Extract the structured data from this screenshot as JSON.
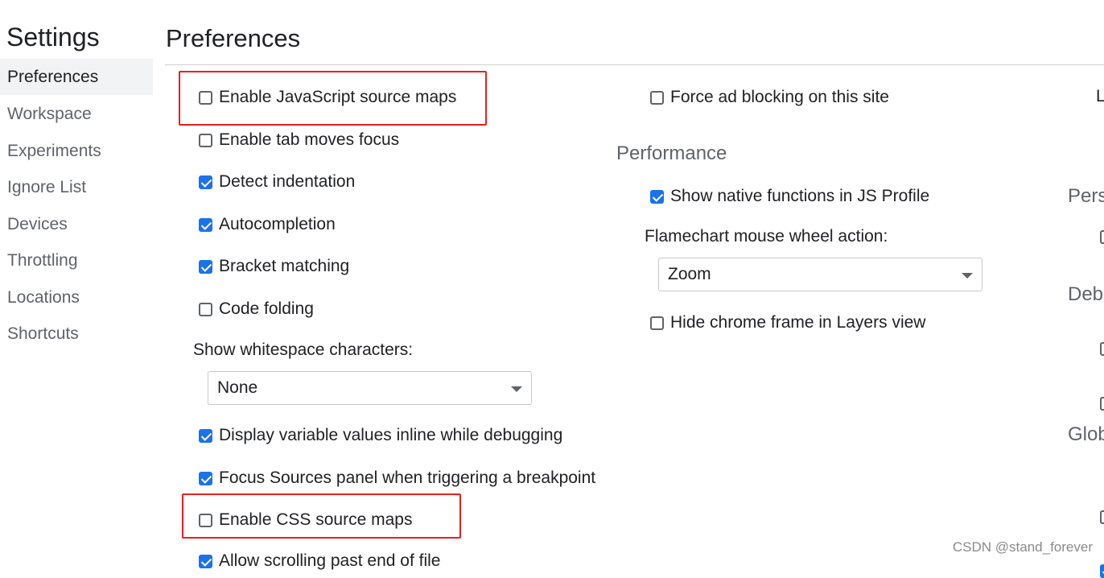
{
  "sidebar": {
    "title": "Settings",
    "items": [
      {
        "label": "Preferences",
        "selected": true
      },
      {
        "label": "Workspace"
      },
      {
        "label": "Experiments"
      },
      {
        "label": "Ignore List"
      },
      {
        "label": "Devices"
      },
      {
        "label": "Throttling"
      },
      {
        "label": "Locations"
      },
      {
        "label": "Shortcuts"
      }
    ]
  },
  "main": {
    "title": "Preferences",
    "left_column": {
      "js_source_maps": {
        "label": "Enable JavaScript source maps",
        "checked": false
      },
      "tab_moves_focus": {
        "label": "Enable tab moves focus",
        "checked": false
      },
      "detect_indentation": {
        "label": "Detect indentation",
        "checked": true
      },
      "autocompletion": {
        "label": "Autocompletion",
        "checked": true
      },
      "bracket_matching": {
        "label": "Bracket matching",
        "checked": true
      },
      "code_folding": {
        "label": "Code folding",
        "checked": false
      },
      "whitespace_label": "Show whitespace characters:",
      "whitespace_select": "None",
      "inline_values": {
        "label": "Display variable values inline while debugging",
        "checked": true
      },
      "focus_sources": {
        "label": "Focus Sources panel when triggering a breakpoint",
        "checked": true
      },
      "css_source_maps": {
        "label": "Enable CSS source maps",
        "checked": false
      },
      "allow_scrolling": {
        "label": "Allow scrolling past end of file",
        "checked": true
      }
    },
    "middle_column": {
      "force_ad_blocking": {
        "label": "Force ad blocking on this site",
        "checked": false
      },
      "performance_title": "Performance",
      "native_functions": {
        "label": "Show native functions in JS Profile",
        "checked": true
      },
      "flamechart_label": "Flamechart mouse wheel action:",
      "flamechart_select": "Zoom",
      "hide_chrome_frame": {
        "label": "Hide chrome frame in Layers view",
        "checked": false
      }
    },
    "right_column_partial": {
      "top_letter": "L",
      "persistence_partial": "Pers",
      "debugger_partial": "Deb",
      "global_partial": "Glob"
    }
  },
  "watermark": "CSDN @stand_forever",
  "colors": {
    "highlight": "#e8201e",
    "checkbox_checked": "#1a73e8"
  }
}
